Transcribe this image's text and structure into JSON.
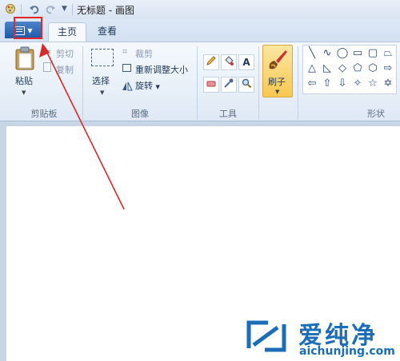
{
  "titlebar": {
    "title": "无标题 - 画图",
    "app_icon": "paint-app-icon",
    "undo_icon": "undo-icon",
    "redo_icon": "redo-icon",
    "customize_icon": "customize-quick-access-icon"
  },
  "tabs": {
    "file_icon": "paint-menu-icon",
    "home": "主页",
    "view": "查看"
  },
  "clipboard": {
    "paste": "粘贴",
    "cut": "剪切",
    "copy": "复制",
    "group": "剪贴板"
  },
  "image": {
    "select": "选择",
    "crop": "裁剪",
    "resize": "重新调整大小",
    "rotate": "旋转",
    "group": "图像"
  },
  "tools": {
    "group": "工具",
    "text_glyph": "A"
  },
  "brushes": {
    "label": "刷子"
  },
  "shapes": {
    "group": "形状"
  },
  "watermark": {
    "text": "爱纯净",
    "url": "aichunjing.com"
  },
  "colors": {
    "accent": "#1d5aa6",
    "highlight_red": "#e2262a",
    "watermark_blue": "#1b6db7"
  }
}
